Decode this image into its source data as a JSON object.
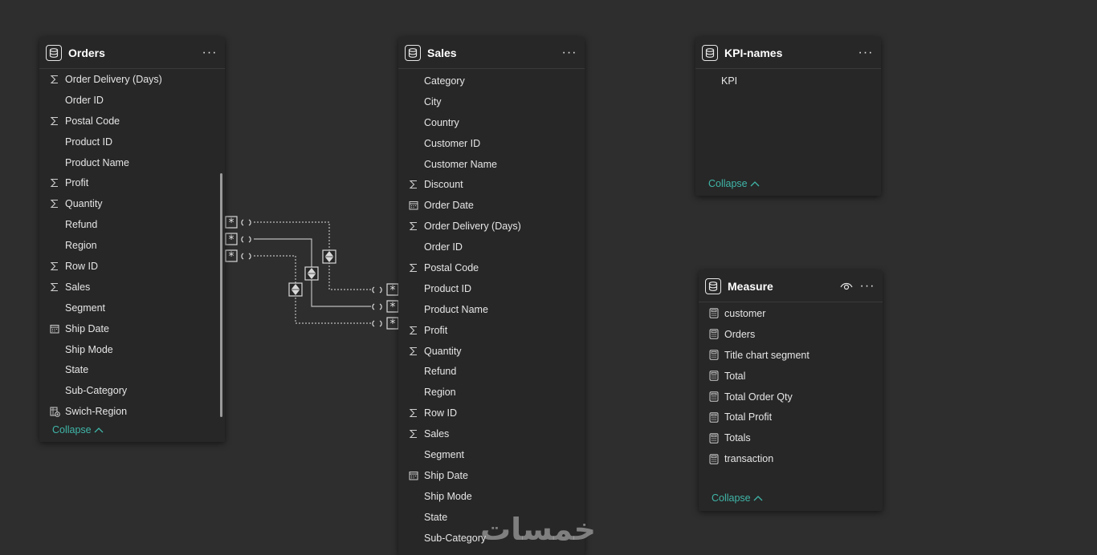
{
  "tables": {
    "orders": {
      "title": "Orders",
      "fields": [
        {
          "label": "Order Delivery (Days)",
          "icon": "sigma-icon"
        },
        {
          "label": "Order ID",
          "icon": ""
        },
        {
          "label": "Postal Code",
          "icon": "sigma-icon"
        },
        {
          "label": "Product ID",
          "icon": ""
        },
        {
          "label": "Product Name",
          "icon": ""
        },
        {
          "label": "Profit",
          "icon": "sigma-icon"
        },
        {
          "label": "Quantity",
          "icon": "sigma-icon"
        },
        {
          "label": "Refund",
          "icon": ""
        },
        {
          "label": "Region",
          "icon": ""
        },
        {
          "label": "Row ID",
          "icon": "sigma-icon"
        },
        {
          "label": "Sales",
          "icon": "sigma-icon"
        },
        {
          "label": "Segment",
          "icon": ""
        },
        {
          "label": "Ship Date",
          "icon": "calendar-icon"
        },
        {
          "label": "Ship Mode",
          "icon": ""
        },
        {
          "label": "State",
          "icon": ""
        },
        {
          "label": "Sub-Category",
          "icon": ""
        },
        {
          "label": "Swich-Region",
          "icon": "field-parameter-icon"
        }
      ],
      "collapse_label": "Collapse"
    },
    "sales": {
      "title": "Sales",
      "fields": [
        {
          "label": "Category",
          "icon": ""
        },
        {
          "label": "City",
          "icon": ""
        },
        {
          "label": "Country",
          "icon": ""
        },
        {
          "label": "Customer ID",
          "icon": ""
        },
        {
          "label": "Customer Name",
          "icon": ""
        },
        {
          "label": "Discount",
          "icon": "sigma-icon"
        },
        {
          "label": "Order Date",
          "icon": "calendar-icon"
        },
        {
          "label": "Order Delivery (Days)",
          "icon": "sigma-icon"
        },
        {
          "label": "Order ID",
          "icon": ""
        },
        {
          "label": "Postal Code",
          "icon": "sigma-icon"
        },
        {
          "label": "Product ID",
          "icon": ""
        },
        {
          "label": "Product Name",
          "icon": ""
        },
        {
          "label": "Profit",
          "icon": "sigma-icon"
        },
        {
          "label": "Quantity",
          "icon": "sigma-icon"
        },
        {
          "label": "Refund",
          "icon": ""
        },
        {
          "label": "Region",
          "icon": ""
        },
        {
          "label": "Row ID",
          "icon": "sigma-icon"
        },
        {
          "label": "Sales",
          "icon": "sigma-icon"
        },
        {
          "label": "Segment",
          "icon": ""
        },
        {
          "label": "Ship Date",
          "icon": "calendar-icon"
        },
        {
          "label": "Ship Mode",
          "icon": ""
        },
        {
          "label": "State",
          "icon": ""
        },
        {
          "label": "Sub-Category",
          "icon": ""
        }
      ]
    },
    "kpi_names": {
      "title": "KPI-names",
      "fields": [
        {
          "label": "KPI",
          "icon": ""
        }
      ],
      "collapse_label": "Collapse"
    },
    "measure": {
      "title": "Measure",
      "fields": [
        {
          "label": "customer",
          "icon": "calculator-icon"
        },
        {
          "label": "Orders",
          "icon": "calculator-icon"
        },
        {
          "label": "Title chart segment",
          "icon": "calculator-icon"
        },
        {
          "label": "Total",
          "icon": "calculator-icon"
        },
        {
          "label": "Total Order Qty",
          "icon": "calculator-icon"
        },
        {
          "label": "Total Profit",
          "icon": "calculator-icon"
        },
        {
          "label": "Totals",
          "icon": "calculator-icon"
        },
        {
          "label": "transaction",
          "icon": "calculator-icon"
        }
      ],
      "collapse_label": "Collapse"
    }
  },
  "watermark": "خمسات",
  "colors": {
    "background": "#2e2e2e",
    "card": "#272727",
    "accent": "#3fb6a8",
    "text": "#e6e6e6"
  }
}
